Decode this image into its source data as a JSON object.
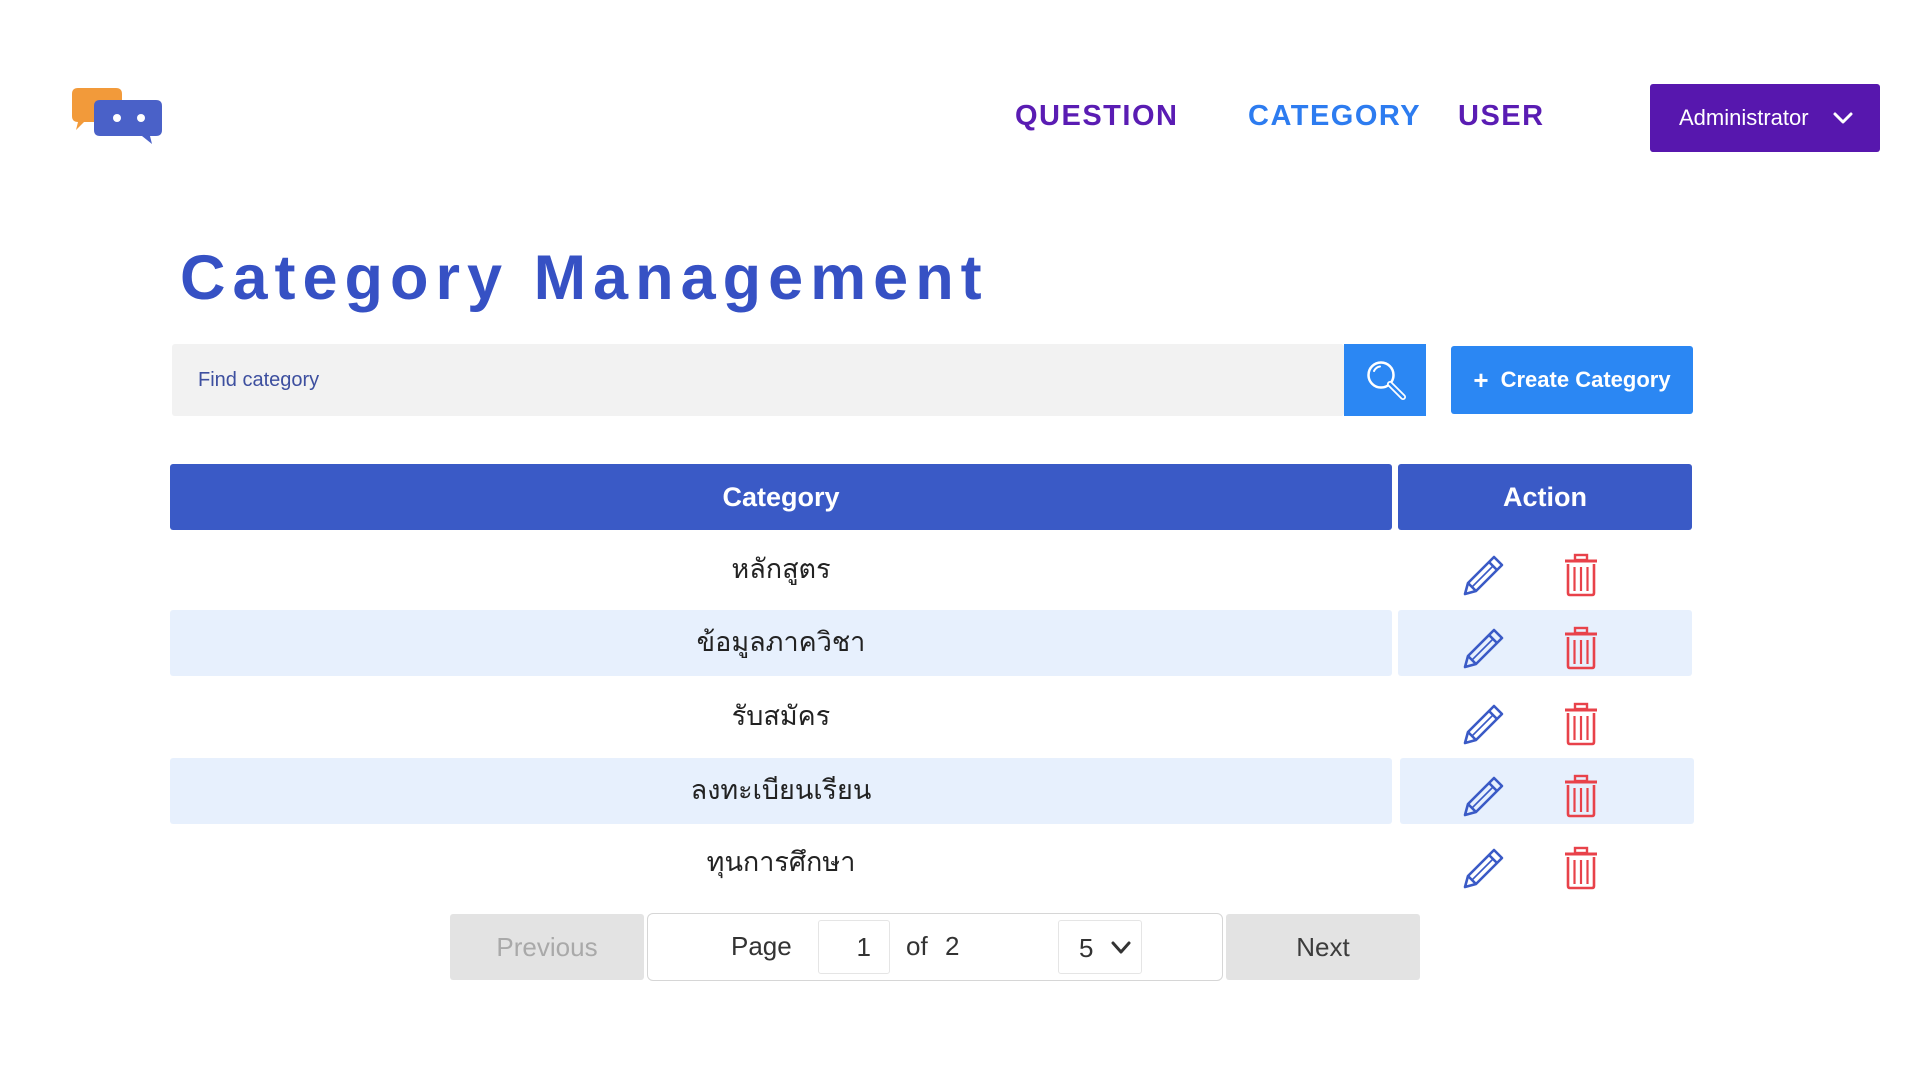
{
  "header": {
    "logo_icon": "chat-bubbles-logo",
    "nav": [
      {
        "label": "QUESTION",
        "color": "#5a1cb3"
      },
      {
        "label": "CATEGORY",
        "color": "#2d7cf0",
        "active": true
      },
      {
        "label": "USER",
        "color": "#5a1cb3"
      }
    ],
    "user_menu": {
      "label": "Administrator",
      "icon": "chevron-down-icon",
      "bg": "#5717ae"
    }
  },
  "page": {
    "title": "Category Management"
  },
  "search": {
    "placeholder": "Find category",
    "value": "",
    "button_icon": "search-icon"
  },
  "create_button": {
    "label": "Create Category",
    "icon": "plus-icon"
  },
  "table": {
    "headers": {
      "category": "Category",
      "action": "Action"
    },
    "header_bg": "#3a5ac6",
    "stripe_bg": "#e7f0fd",
    "rows": [
      {
        "category": "หลักสูตร"
      },
      {
        "category": "ข้อมูลภาควิชา"
      },
      {
        "category": "รับสมัคร"
      },
      {
        "category": "ลงทะเบียนเรียน"
      },
      {
        "category": "ทุนการศึกษา"
      }
    ],
    "row_actions": [
      {
        "icon": "pencil-icon",
        "color": "#3a5ac6"
      },
      {
        "icon": "trash-icon",
        "color": "#e8424a"
      }
    ]
  },
  "pagination": {
    "previous_label": "Previous",
    "page_label": "Page",
    "current_page": "1",
    "of_label": "of",
    "total_pages": "2",
    "page_size": "5",
    "next_label": "Next"
  }
}
